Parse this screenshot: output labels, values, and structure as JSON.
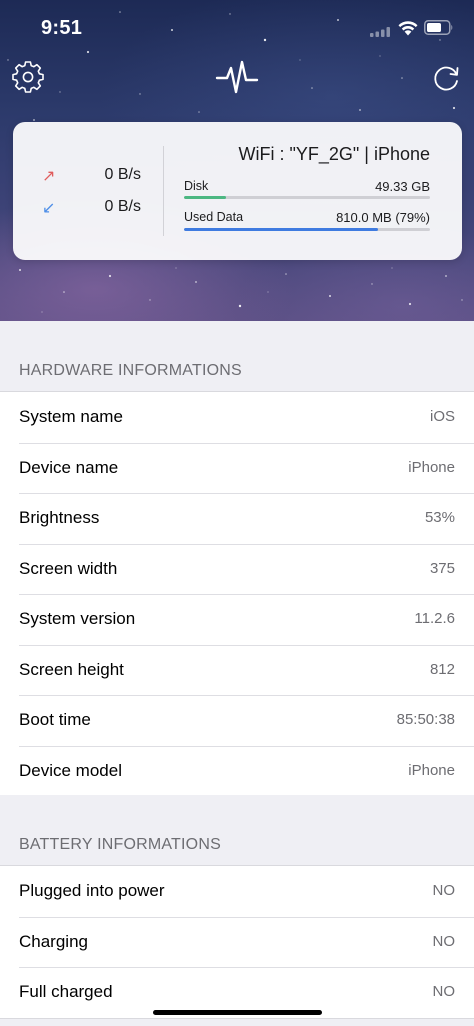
{
  "status_bar": {
    "time": "9:51"
  },
  "network": {
    "upload_speed": "0 B/s",
    "download_speed": "0 B/s",
    "connection": "WiFi : \"YF_2G\"  |  iPhone",
    "disk": {
      "label": "Disk",
      "value": "49.33 GB",
      "fill_percent": 17,
      "color": "#4cb782"
    },
    "used_data": {
      "label": "Used Data",
      "value": "810.0 MB (79%)",
      "fill_percent": 79,
      "color": "#3f7be0"
    }
  },
  "hardware": {
    "title": "HARDWARE INFORMATIONS",
    "rows": [
      {
        "label": "System name",
        "value": "iOS"
      },
      {
        "label": "Device name",
        "value": "iPhone"
      },
      {
        "label": "Brightness",
        "value": "53%"
      },
      {
        "label": "Screen width",
        "value": "375"
      },
      {
        "label": "System version",
        "value": "11.2.6"
      },
      {
        "label": "Screen height",
        "value": "812"
      },
      {
        "label": "Boot time",
        "value": "85:50:38"
      },
      {
        "label": "Device model",
        "value": "iPhone"
      }
    ]
  },
  "battery": {
    "title": "BATTERY INFORMATIONS",
    "rows": [
      {
        "label": "Plugged into power",
        "value": "NO"
      },
      {
        "label": "Charging",
        "value": "NO"
      },
      {
        "label": "Full charged",
        "value": "NO"
      }
    ]
  },
  "icons": {
    "settings": "gear-icon",
    "logo": "pulse-icon",
    "refresh": "refresh-icon",
    "upload": "arrow-up-right-icon",
    "download": "arrow-down-left-icon"
  }
}
